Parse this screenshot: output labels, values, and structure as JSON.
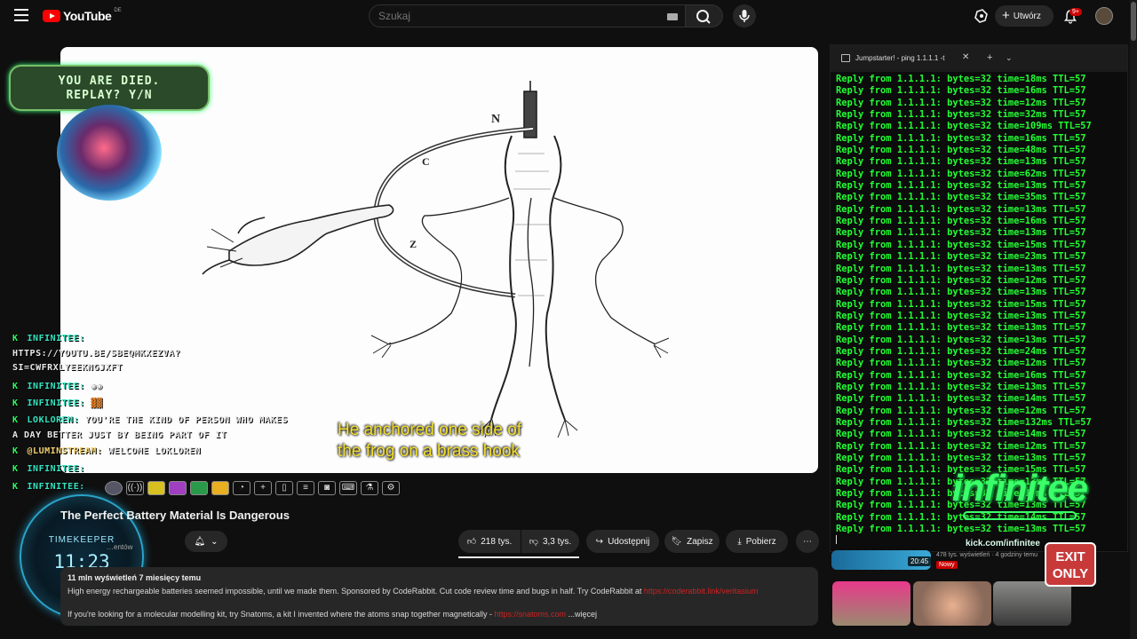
{
  "header": {
    "logo_text": "YouTube",
    "region": "DE",
    "search_placeholder": "Szukaj",
    "create_label": "Utwórz",
    "notifications_badge": "9+"
  },
  "overlay": {
    "died_line1": "YOU ARE DIED.",
    "died_line2": "REPLAY? Y/N",
    "subtitle_line1": "He anchored one side of",
    "subtitle_line2": "the frog on a brass hook",
    "timekeeper_label": "TIMEKEEPER",
    "timekeeper_time": "11:23",
    "kick_url": "kick.com/infinitee",
    "logo_text": "infinitee",
    "exit_line1": "EXIT",
    "exit_line2": "ONLY"
  },
  "chat": [
    {
      "user": "INFINITEE:",
      "msg": ""
    },
    {
      "user": "",
      "msg": "HTTPS://YOUTU.BE/SBEQMKXEZVA?"
    },
    {
      "user": "",
      "msg": "SI=CWFRXLYEEKNGJXFT"
    },
    {
      "user": "INFINITEE:",
      "msg": ""
    },
    {
      "user": "INFINITEE:",
      "msg": ""
    },
    {
      "user": "LOKLOREN:",
      "msg": "YOU'RE THE KIND OF PERSON WHO MAKES"
    },
    {
      "user": "",
      "msg": "A DAY BETTER JUST BY BEING PART OF IT"
    },
    {
      "user": "@LUMINSTREAM:",
      "msg": "WELCOME LOKLOREN"
    },
    {
      "user": "INFINITEE:",
      "msg": ""
    },
    {
      "user": "INFINITEE:",
      "msg": ""
    }
  ],
  "chat_prefix": "K",
  "video": {
    "title": "The Perfect Battery Material Is Dangerous",
    "subscribers_partial": "…entów",
    "likes": "218 tys.",
    "dislikes": "3,3 tys.",
    "share_label": "Udostępnij",
    "save_label": "Zapisz",
    "download_label": "Pobierz",
    "views_date": "11 mln wyświetleń  7 miesięcy temu",
    "desc_line1": "High energy rechargeable batteries seemed impossible, until we made them. Sponsored by CodeRabbit. Cut code review time and bugs in half. Try CodeRabbit at",
    "desc_link1": "https://coderabbit.link/veritasium",
    "desc_line2": "If you're looking for a molecular modelling kit, try Snatoms, a kit I invented where the atoms snap together magnetically -",
    "desc_link2": "https://snatoms.com",
    "more_label": "...więcej"
  },
  "diagram_labels": {
    "n": "N",
    "c": "C",
    "z": "Z"
  },
  "terminal": {
    "tab_title": "Jumpstarter! - ping  1.1.1.1 -t",
    "lines": [
      "Reply from 1.1.1.1: bytes=32 time=18ms TTL=57",
      "Reply from 1.1.1.1: bytes=32 time=16ms TTL=57",
      "Reply from 1.1.1.1: bytes=32 time=12ms TTL=57",
      "Reply from 1.1.1.1: bytes=32 time=32ms TTL=57",
      "Reply from 1.1.1.1: bytes=32 time=109ms TTL=57",
      "Reply from 1.1.1.1: bytes=32 time=16ms TTL=57",
      "Reply from 1.1.1.1: bytes=32 time=48ms TTL=57",
      "Reply from 1.1.1.1: bytes=32 time=13ms TTL=57",
      "Reply from 1.1.1.1: bytes=32 time=62ms TTL=57",
      "Reply from 1.1.1.1: bytes=32 time=13ms TTL=57",
      "Reply from 1.1.1.1: bytes=32 time=35ms TTL=57",
      "Reply from 1.1.1.1: bytes=32 time=13ms TTL=57",
      "Reply from 1.1.1.1: bytes=32 time=16ms TTL=57",
      "Reply from 1.1.1.1: bytes=32 time=13ms TTL=57",
      "Reply from 1.1.1.1: bytes=32 time=15ms TTL=57",
      "Reply from 1.1.1.1: bytes=32 time=23ms TTL=57",
      "Reply from 1.1.1.1: bytes=32 time=13ms TTL=57",
      "Reply from 1.1.1.1: bytes=32 time=12ms TTL=57",
      "Reply from 1.1.1.1: bytes=32 time=13ms TTL=57",
      "Reply from 1.1.1.1: bytes=32 time=15ms TTL=57",
      "Reply from 1.1.1.1: bytes=32 time=13ms TTL=57",
      "Reply from 1.1.1.1: bytes=32 time=13ms TTL=57",
      "Reply from 1.1.1.1: bytes=32 time=13ms TTL=57",
      "Reply from 1.1.1.1: bytes=32 time=24ms TTL=57",
      "Reply from 1.1.1.1: bytes=32 time=12ms TTL=57",
      "Reply from 1.1.1.1: bytes=32 time=16ms TTL=57",
      "Reply from 1.1.1.1: bytes=32 time=13ms TTL=57",
      "Reply from 1.1.1.1: bytes=32 time=14ms TTL=57",
      "Reply from 1.1.1.1: bytes=32 time=12ms TTL=57",
      "Reply from 1.1.1.1: bytes=32 time=132ms TTL=57",
      "Reply from 1.1.1.1: bytes=32 time=14ms TTL=57",
      "Reply from 1.1.1.1: bytes=32 time=12ms TTL=57",
      "Reply from 1.1.1.1: bytes=32 time=13ms TTL=57",
      "Reply from 1.1.1.1: bytes=32 time=15ms TTL=57",
      "Reply from 1.1.1.1: bytes=32 time=13ms TTL=57",
      "Reply from 1.1.1.1: bytes=32 time=13ms TTL=57",
      "Reply from 1.1.1.1: bytes=32 time=13ms TTL=57",
      "Reply from 1.1.1.1: bytes=32 time=14ms TTL=57",
      "Reply from 1.1.1.1: bytes=32 time=13ms TTL=57"
    ]
  },
  "recommended": {
    "duration": "20:45",
    "meta": "478 tys. wyświetleń · 4 godziny temu",
    "tag": "Nowy"
  },
  "colors": {
    "accent_red": "#ff0000",
    "terminal_green": "#22ff33",
    "subtitle_yellow": "#f5e02a"
  }
}
